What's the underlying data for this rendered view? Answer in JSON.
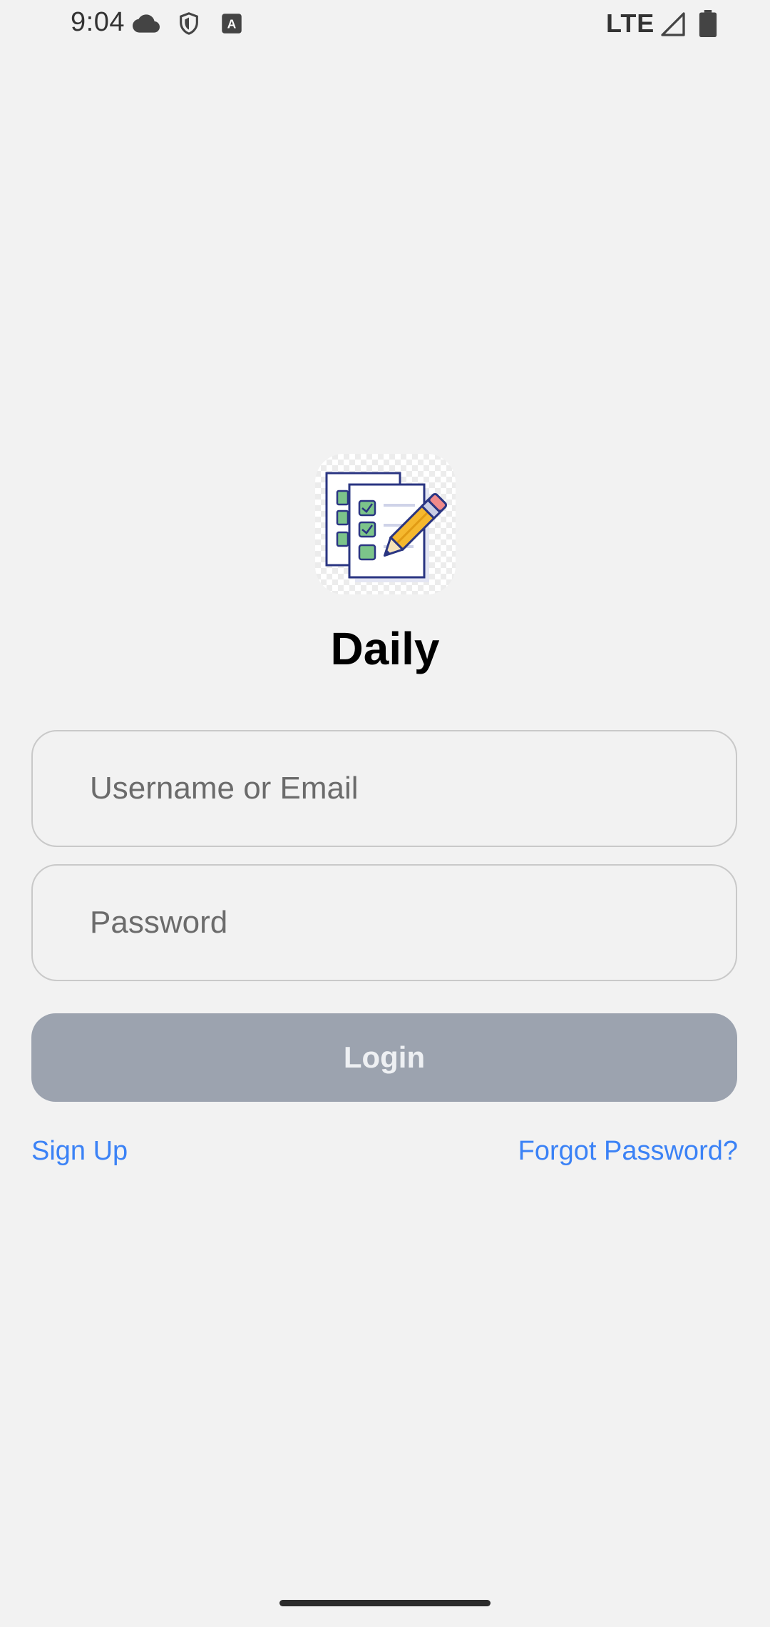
{
  "status_bar": {
    "time": "9:04",
    "network": "LTE",
    "icons": [
      "cloud-icon",
      "shield-icon",
      "a-notification-icon",
      "signal-icon",
      "battery-icon"
    ]
  },
  "app": {
    "name": "Daily",
    "logo_icon": "checklist-pencil-icon"
  },
  "form": {
    "username_placeholder": "Username or Email",
    "password_placeholder": "Password",
    "login_label": "Login",
    "signup_label": "Sign Up",
    "forgot_label": "Forgot Password?"
  },
  "colors": {
    "background": "#f2f2f2",
    "button_disabled": "#9ca3af",
    "link": "#3b82f6"
  }
}
